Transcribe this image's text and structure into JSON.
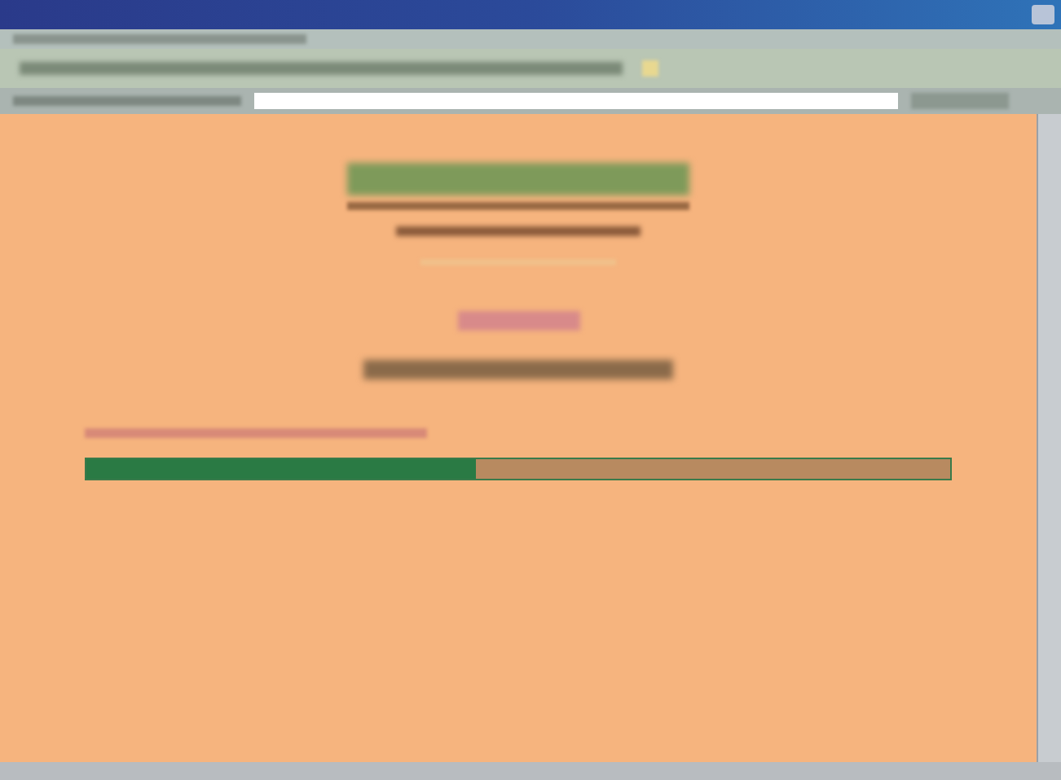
{
  "progress_bar": {
    "level": 0.45
  }
}
